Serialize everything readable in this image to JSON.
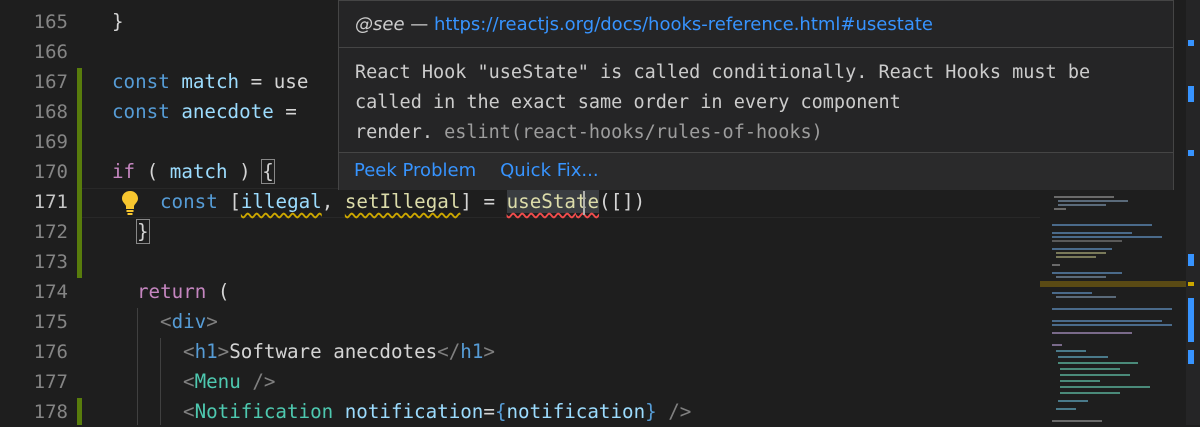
{
  "editor": {
    "lines": [
      {
        "n": "165"
      },
      {
        "n": "166"
      },
      {
        "n": "167"
      },
      {
        "n": "168"
      },
      {
        "n": "169"
      },
      {
        "n": "170"
      },
      {
        "n": "171"
      },
      {
        "n": "172"
      },
      {
        "n": "173"
      },
      {
        "n": "174"
      },
      {
        "n": "175"
      },
      {
        "n": "176"
      },
      {
        "n": "177"
      },
      {
        "n": "178"
      }
    ],
    "code": {
      "l165": "}",
      "l167_kw": "const",
      "l167_var": "match",
      "l167_rest": " = use",
      "l168_kw": "const",
      "l168_var": "anecdote",
      "l168_rest": " =",
      "l170_if": "if",
      "l170_a": " ( ",
      "l170_var": "match",
      "l170_b": " ) ",
      "l170_brace": "{",
      "l171_kw": "const",
      "l171_open": " [",
      "l171_illegal": "illegal",
      "l171_comma": ", ",
      "l171_set": "setIllegal",
      "l171_close": "] = ",
      "l171_use1": "useSta",
      "l171_use2": "te",
      "l171_tail": "([])",
      "l172_brace": "}",
      "l174_ret": "return",
      "l174_rest": " (",
      "l175_open": "<",
      "l175_tag": "div",
      "l175_close": ">",
      "l176_open": "<",
      "l176_tag": "h1",
      "l176_close": ">",
      "l176_text": "Software anecdotes",
      "l176_etag_open": "</",
      "l176_etag": "h1",
      "l176_etag_close": ">",
      "l177_open": "<",
      "l177_comp": "Menu",
      "l177_close": " />",
      "l178_open": "<",
      "l178_comp": "Notification",
      "l178_attr": " notification",
      "l178_eq": "=",
      "l178_b1": "{",
      "l178_val": "notification",
      "l178_b2": "}",
      "l178_close": " />"
    }
  },
  "hover": {
    "see_tag": "@see",
    "dash": " — ",
    "link": "https://reactjs.org/docs/hooks-reference.html#usestate",
    "message_line1": "React Hook \"useState\" is called conditionally. React Hooks must be",
    "message_line2": "called in the exact same order in every component",
    "message_line3": "render. ",
    "source": "eslint(react-hooks/rules-of-hooks)",
    "actions": {
      "peek": "Peek Problem",
      "quickfix": "Quick Fix..."
    }
  },
  "colors": {
    "background": "#1e1e1e",
    "git_added": "#587c0c",
    "warning": "#cca700",
    "link": "#3794ff"
  },
  "icons": {
    "lightbulb": "lightbulb-icon"
  }
}
